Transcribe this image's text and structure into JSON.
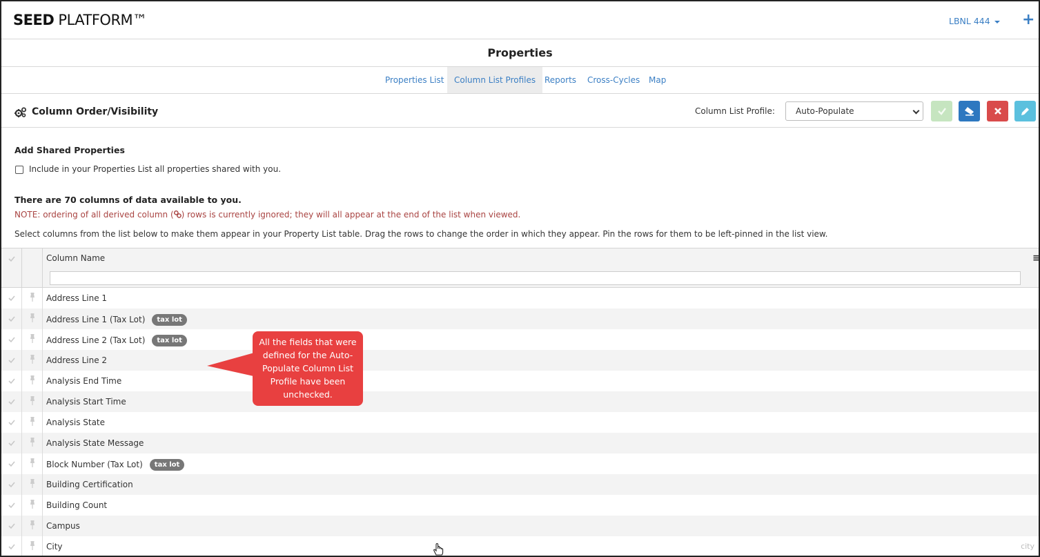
{
  "app": {
    "brand_bold": "SEED",
    "brand_rest": " PLATFORM™",
    "org": "LBNL 444",
    "add_icon": "plus-icon"
  },
  "page": {
    "title": "Properties"
  },
  "tabs": [
    {
      "label": "Properties List",
      "active": false
    },
    {
      "label": "Column List Profiles",
      "active": true
    },
    {
      "label": "Reports",
      "active": false
    },
    {
      "label": "Cross-Cycles",
      "active": false
    },
    {
      "label": "Map",
      "active": false
    }
  ],
  "section": {
    "title": "Column Order/Visibility",
    "icon": "gears-icon",
    "profile_label": "Column List Profile:",
    "profile_value": "Auto-Populate"
  },
  "shared": {
    "title": "Add Shared Properties",
    "checkbox_label": "Include in your Properties List all properties shared with you.",
    "checked": false
  },
  "info": {
    "count": "There are 70 columns of data available to you.",
    "note_before": "NOTE: ordering of all derived column (",
    "note_after": ") rows is currently ignored; they will all appear at the end of the list when viewed.",
    "help": "Select columns from the list below to make them appear in your Property List table. Drag the rows to change the order in which they appear. Pin the rows for them to be left-pinned in the list view."
  },
  "grid": {
    "header": "Column Name",
    "filter_value": "",
    "rows": [
      {
        "name": "Address Line 1",
        "badge": ""
      },
      {
        "name": "Address Line 1 (Tax Lot)",
        "badge": "tax lot"
      },
      {
        "name": "Address Line 2 (Tax Lot)",
        "badge": "tax lot"
      },
      {
        "name": "Address Line 2",
        "badge": ""
      },
      {
        "name": "Analysis End Time",
        "badge": ""
      },
      {
        "name": "Analysis Start Time",
        "badge": ""
      },
      {
        "name": "Analysis State",
        "badge": ""
      },
      {
        "name": "Analysis State Message",
        "badge": ""
      },
      {
        "name": "Block Number (Tax Lot)",
        "badge": "tax lot"
      },
      {
        "name": "Building Certification",
        "badge": ""
      },
      {
        "name": "Building Count",
        "badge": ""
      },
      {
        "name": "Campus",
        "badge": ""
      },
      {
        "name": "City",
        "badge": "",
        "hint": "city"
      }
    ]
  },
  "callout": {
    "text": "All the fields that were defined for the Auto-Populate Column List Profile have been unchecked.",
    "color": "#e84040"
  }
}
